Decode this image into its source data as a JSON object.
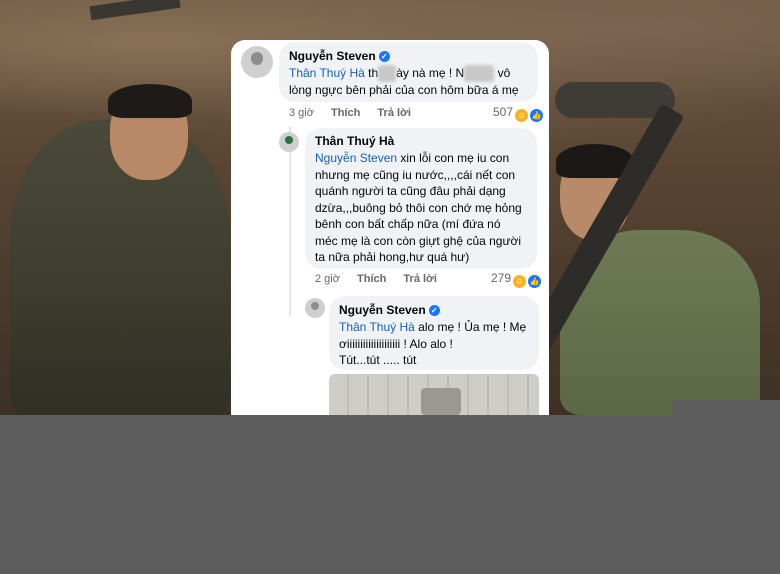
{
  "comments": [
    {
      "author": "Nguyễn Steven",
      "verified": true,
      "mention": "Thân Thuý Hà",
      "line1_a": "th",
      "line1_b": "ày nà mẹ ! N",
      "line1_c": "vô",
      "line2": "lòng ngực bên phải của con hôm bữa á mẹ",
      "time": "3 giờ",
      "like": "Thích",
      "reply": "Trả lời",
      "reactions": "507",
      "reaction_icons": [
        "haha-icon",
        "like-icon"
      ]
    },
    {
      "author": "Thân Thuý Hà",
      "verified": false,
      "mention": "Nguyễn Steven",
      "line1": "xin lỗi con mẹ iu con",
      "line2": "nhưng mẹ cũng iu nước,,,,cái nết con",
      "line3": "quánh người ta cũng đâu phải dạng",
      "line4": "dzừa,,,buông bỏ thôi con chớ mẹ hỏng",
      "line5": "bênh con bất chấp nữa (mí đứa nó",
      "line6": "méc mẹ là con còn giựt ghệ của người",
      "line7": "ta nữa phải hong,hư quá hư)",
      "time": "2 giờ",
      "like": "Thích",
      "reply": "Trả lời",
      "reactions": "279",
      "reaction_icons": [
        "haha-icon",
        "like-icon"
      ]
    },
    {
      "author": "Nguyễn Steven",
      "verified": true,
      "mention": "Thân Thuý Hà",
      "line1": "alo mẹ ! Ủa mẹ ! Mẹ",
      "line2": "ơiiiiiiiiiiiiiiiiiiii ! Alo alo !",
      "line3": "Tút...tút ..... tút"
    }
  ],
  "colors": {
    "mention": "#1a5fb4",
    "verified": "#1877f2",
    "bubble": "#f0f2f5",
    "overlay": "#5d5d5d"
  }
}
